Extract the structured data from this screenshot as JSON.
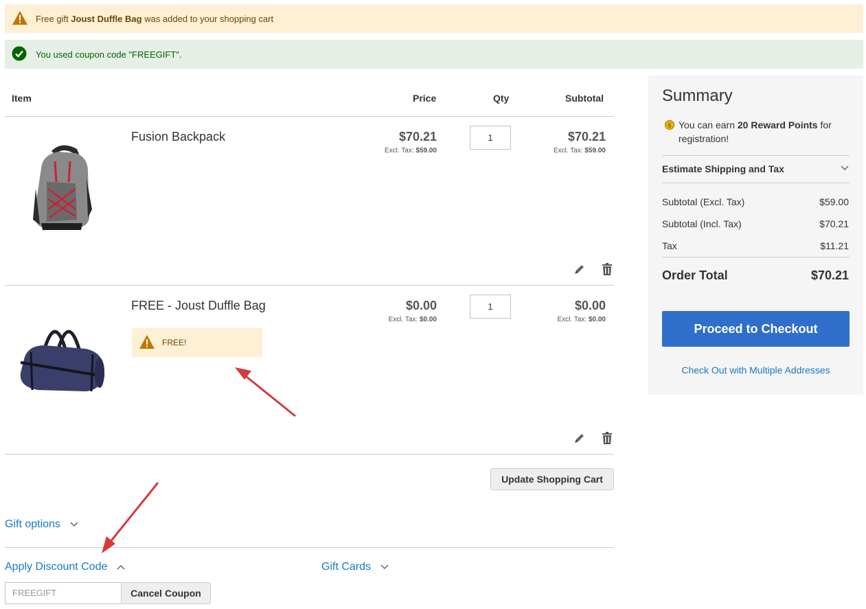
{
  "messages": {
    "warning_prefix": "Free gift ",
    "warning_product": "Joust Duffle Bag",
    "warning_suffix": " was added to your shopping cart",
    "success": "You used coupon code \"FREEGIFT\"."
  },
  "cart": {
    "headers": {
      "item": "Item",
      "price": "Price",
      "qty": "Qty",
      "subtotal": "Subtotal"
    },
    "items": [
      {
        "name": "Fusion Backpack",
        "price": "$70.21",
        "excl_label": "Excl. Tax: ",
        "excl_value": "$59.00",
        "qty": "1",
        "subtotal": "$70.21",
        "subtotal_excl_value": "$59.00"
      },
      {
        "name": "FREE - Joust Duffle Bag",
        "price": "$0.00",
        "excl_label": "Excl. Tax: ",
        "excl_value": "$0.00",
        "qty": "1",
        "subtotal": "$0.00",
        "subtotal_excl_value": "$0.00",
        "badge": "FREE!"
      }
    ],
    "update_button": "Update Shopping Cart"
  },
  "sections": {
    "gift_options": "Gift options",
    "apply_discount": "Apply Discount Code",
    "gift_cards": "Gift Cards"
  },
  "coupon": {
    "placeholder": "FREEGIFT",
    "cancel_button": "Cancel Coupon"
  },
  "summary": {
    "title": "Summary",
    "reward_prefix": "You can earn ",
    "reward_points": "20 Reward Points",
    "reward_suffix": " for registration!",
    "estimate": "Estimate Shipping and Tax",
    "rows": [
      {
        "label": "Subtotal (Excl. Tax)",
        "value": "$59.00"
      },
      {
        "label": "Subtotal (Incl. Tax)",
        "value": "$70.21"
      },
      {
        "label": "Tax",
        "value": "$11.21"
      }
    ],
    "order_total_label": "Order Total",
    "order_total_value": "$70.21",
    "checkout_button": "Proceed to Checkout",
    "multi_address": "Check Out with Multiple Addresses"
  },
  "colors": {
    "link": "#1979c3",
    "checkout": "#2f6fcb",
    "warning_bg": "#fdf0d5",
    "success_bg": "#e5efe5",
    "annotation_arrow": "#e03030"
  }
}
